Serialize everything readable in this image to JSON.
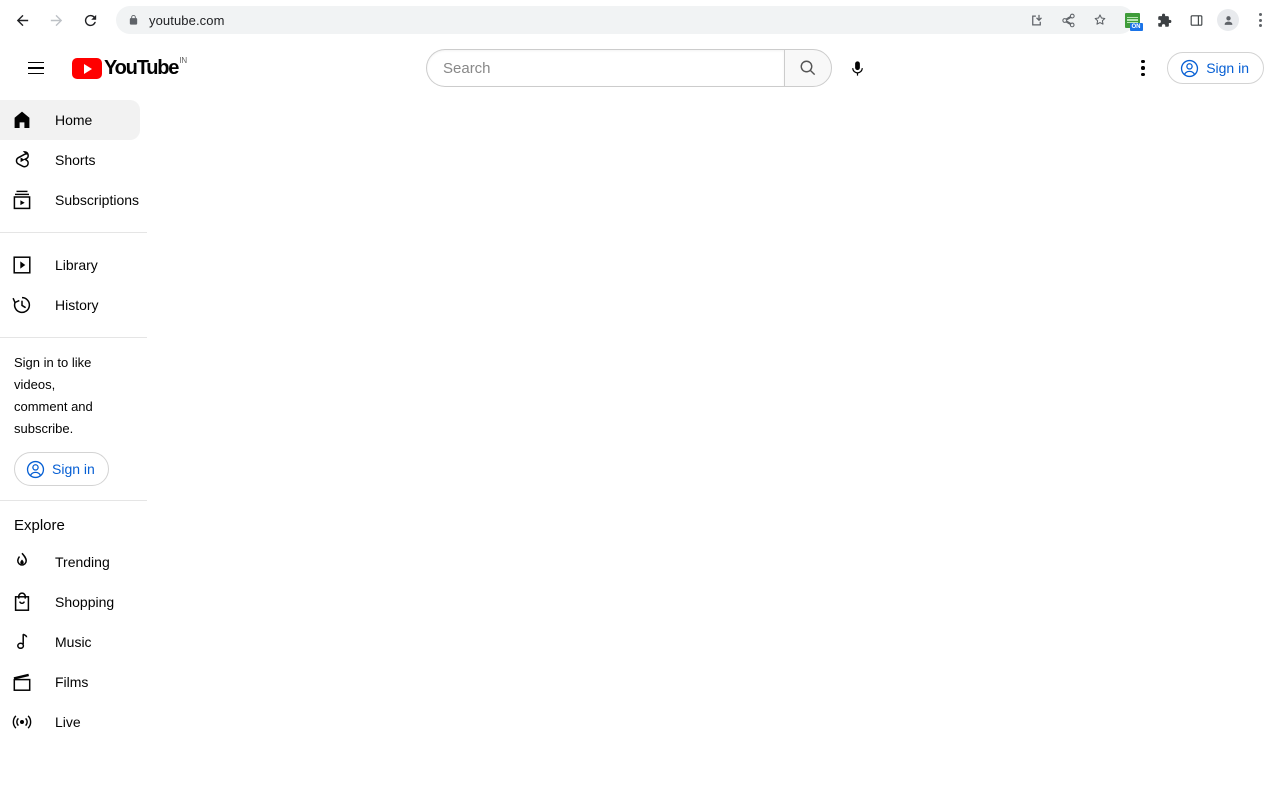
{
  "browser": {
    "back_icon": "back-arrow-icon",
    "forward_icon": "forward-arrow-icon",
    "reload_icon": "reload-icon",
    "lock_icon": "lock-icon",
    "url": "youtube.com",
    "actions": [
      {
        "name": "install-app-icon",
        "label": "Install"
      },
      {
        "name": "share-icon",
        "label": "Share"
      },
      {
        "name": "bookmark-star-icon",
        "label": "Bookmark"
      },
      {
        "name": "extension-active-icon",
        "label": "ON"
      },
      {
        "name": "puzzle-extensions-icon",
        "label": "Extensions"
      },
      {
        "name": "side-panel-icon",
        "label": "Side panel"
      },
      {
        "name": "profile-avatar-icon",
        "label": "Profile"
      },
      {
        "name": "chrome-menu-icon",
        "label": "Customize and control"
      }
    ]
  },
  "masthead": {
    "menu_icon": "guide-hamburger-icon",
    "logo_text": "YouTube",
    "logo_country": "IN",
    "search": {
      "placeholder": "Search",
      "value": "",
      "search_icon": "search-icon",
      "mic_icon": "microphone-icon"
    },
    "settings_icon": "more-vertical-icon",
    "signin_label": "Sign in",
    "signin_icon": "account-circle-icon"
  },
  "sidebar": {
    "primary": [
      {
        "label": "Home",
        "icon": "home-icon",
        "active": true
      },
      {
        "label": "Shorts",
        "icon": "shorts-icon",
        "active": false
      },
      {
        "label": "Subscriptions",
        "icon": "subscriptions-icon",
        "active": false
      }
    ],
    "secondary": [
      {
        "label": "Library",
        "icon": "library-icon",
        "active": false
      },
      {
        "label": "History",
        "icon": "history-icon",
        "active": false
      }
    ],
    "signin_prompt": {
      "text_line1": "Sign in to like videos,",
      "text_line2": "comment and subscribe.",
      "button_label": "Sign in",
      "button_icon": "account-circle-icon"
    },
    "explore_title": "Explore",
    "explore": [
      {
        "label": "Trending",
        "icon": "trending-flame-icon",
        "active": false
      },
      {
        "label": "Shopping",
        "icon": "shopping-bag-icon",
        "active": false
      },
      {
        "label": "Music",
        "icon": "music-note-icon",
        "active": false
      },
      {
        "label": "Films",
        "icon": "films-clapperboard-icon",
        "active": false
      },
      {
        "label": "Live",
        "icon": "live-broadcast-icon",
        "active": false
      }
    ]
  },
  "colors": {
    "brand_red": "#ff0000",
    "link_blue": "#065fd4",
    "active_bg": "#f2f2f2",
    "text": "#030303"
  }
}
